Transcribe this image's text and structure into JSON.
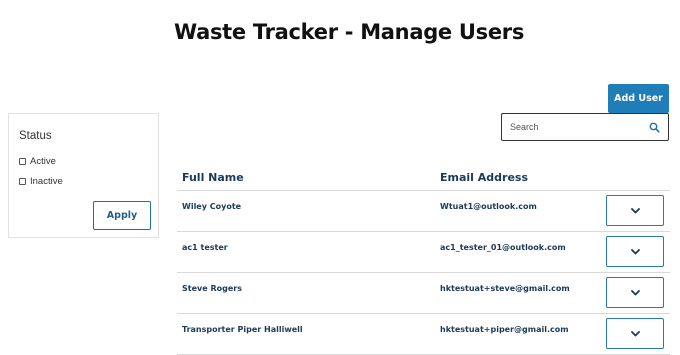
{
  "header": {
    "title": "Waste Tracker - Manage Users"
  },
  "toolbar": {
    "add_user_label": "Add User",
    "search_placeholder": "Search",
    "search_value": ""
  },
  "filters": {
    "title": "Status",
    "options": [
      {
        "label": "Active",
        "checked": false
      },
      {
        "label": "Inactive",
        "checked": false
      }
    ],
    "apply_label": "Apply"
  },
  "table": {
    "columns": [
      "Full Name",
      "Email Address"
    ],
    "rows": [
      {
        "name": "Wiley Coyote",
        "email": "Wtuat1@outlook.com"
      },
      {
        "name": "ac1 tester",
        "email": "ac1_tester_01@outlook.com"
      },
      {
        "name": "Steve Rogers",
        "email": "hktestuat+steve@gmail.com"
      },
      {
        "name": "Transporter Piper Halliwell",
        "email": "hktestuat+piper@gmail.com"
      }
    ],
    "row_action_icon": "chevron-down-icon"
  },
  "colors": {
    "accent": "#1f7db8",
    "table_text": "#1c3a57"
  }
}
